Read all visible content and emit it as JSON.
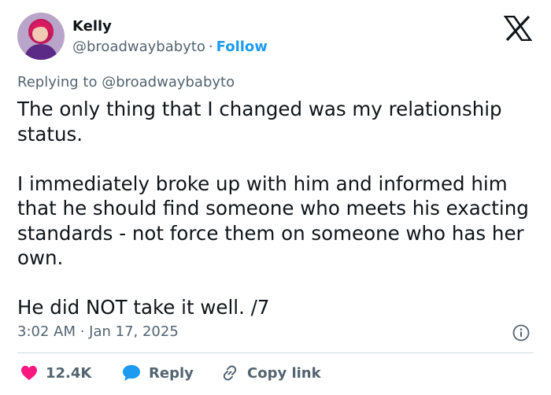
{
  "author": {
    "name": "Kelly",
    "handle": "@broadwaybabyto",
    "separator": "·",
    "follow_label": "Follow"
  },
  "icons": {
    "avatar": "profile-photo",
    "brand": "x-logo-icon",
    "info": "info-icon",
    "like": "heart-icon",
    "reply": "speech-bubble-icon",
    "copy": "link-icon"
  },
  "colors": {
    "accent": "#1d9bf0",
    "like": "#f91880",
    "muted": "#536471",
    "text": "#0f1419"
  },
  "tweet": {
    "replying_to": "Replying to @broadwaybabyto",
    "paragraphs": [
      "The only thing that I changed was my relationship status.",
      "I immediately broke up with him and informed him that he should find someone who meets his exacting standards - not force them on someone who has her own.",
      "He did NOT take it well. /7"
    ],
    "timestamp": "3:02 AM · Jan 17, 2025"
  },
  "actions": {
    "likes": "12.4K",
    "reply_label": "Reply",
    "copy_label": "Copy link"
  }
}
